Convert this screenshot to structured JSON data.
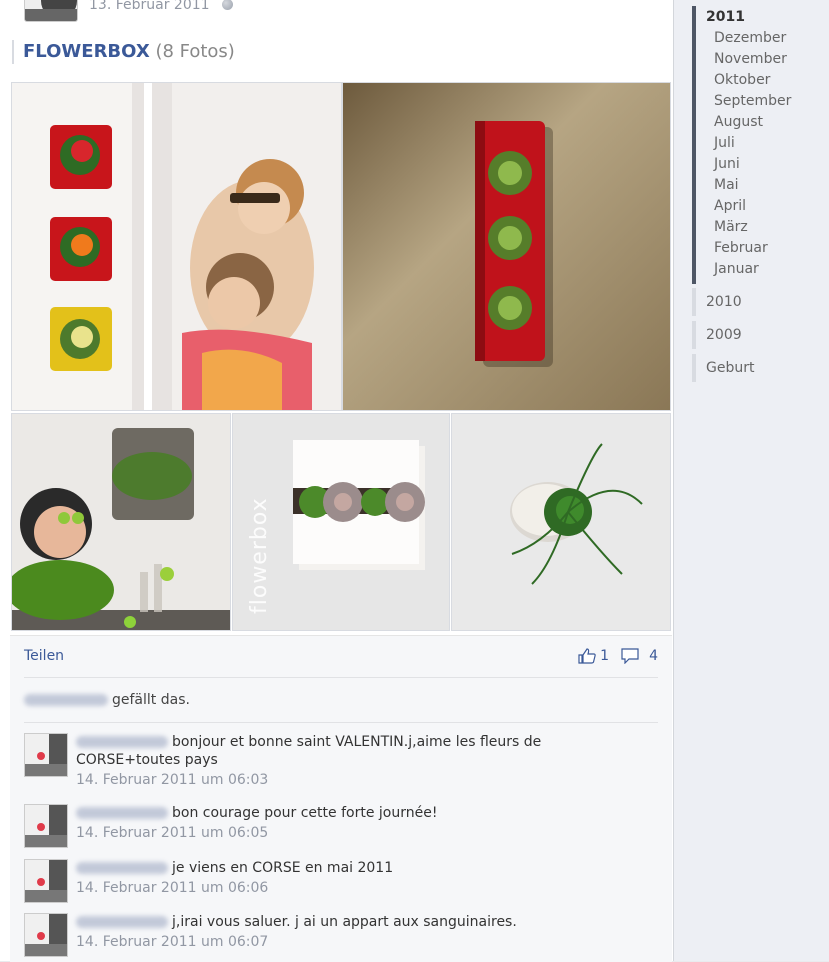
{
  "post": {
    "date": "13. Februar 2011",
    "album_name": "FLOWERBOX",
    "album_count": "(8 Fotos)"
  },
  "photos": {
    "watermark": "flowerbox"
  },
  "actions": {
    "share_label": "Teilen",
    "like_count": "1",
    "comment_count": "4",
    "likes_text": "gefällt das."
  },
  "comments": [
    {
      "text": "bonjour et bonne saint VALENTIN.j,aime les fleurs de CORSE+toutes pays",
      "time": "14. Februar 2011 um 06:03"
    },
    {
      "text": "bon courage pour cette forte journée!",
      "time": "14. Februar 2011 um 06:05"
    },
    {
      "text": "je viens en CORSE en mai 2011",
      "time": "14. Februar 2011 um 06:06"
    },
    {
      "text": "j,irai vous saluer. j ai un appart aux sanguinaires.",
      "time": "14. Februar 2011 um 06:07"
    }
  ],
  "timeline": {
    "current_year": "2011",
    "months": [
      "Dezember",
      "November",
      "Oktober",
      "September",
      "August",
      "Juli",
      "Juni",
      "Mai",
      "April",
      "März",
      "Februar",
      "Januar"
    ],
    "other_years": [
      "2010",
      "2009",
      "Geburt"
    ]
  },
  "colors": {
    "link": "#3b5998",
    "muted": "#9197a3",
    "timeline_active": "#4e5665"
  },
  "icons": [
    "globe-icon",
    "like-icon",
    "comment-icon"
  ]
}
